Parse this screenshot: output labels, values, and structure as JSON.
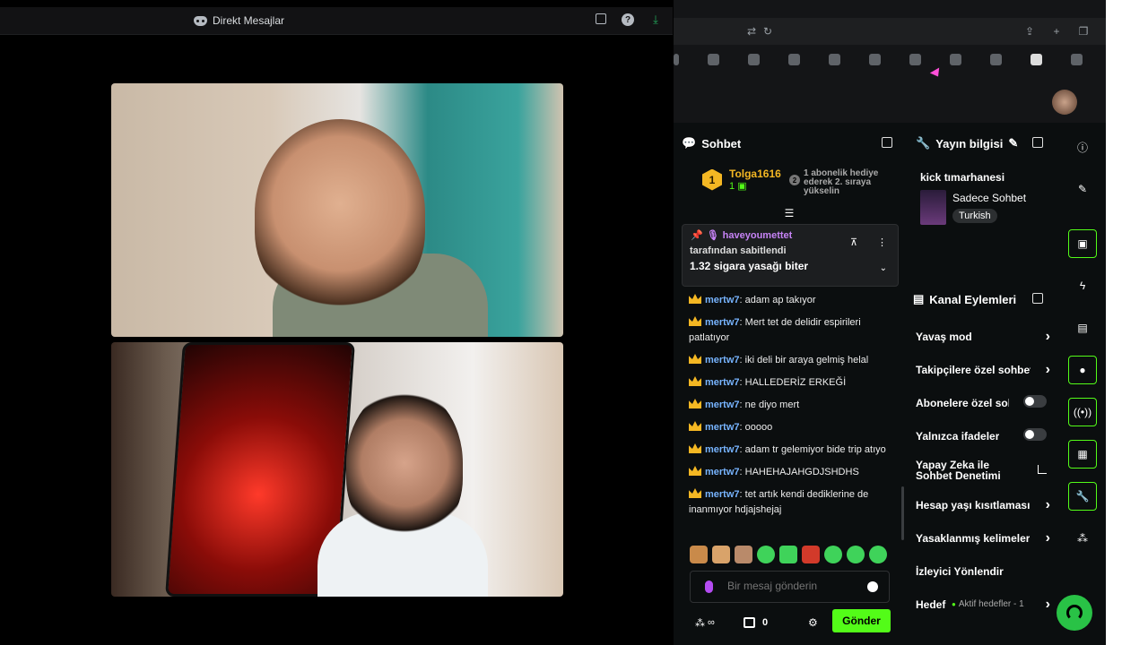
{
  "dm": {
    "title": "Direkt Mesajlar"
  },
  "chat": {
    "header": "Sohbet",
    "sub_goal": {
      "rank": "1",
      "user": "Tolga1616",
      "gift_count": "1",
      "hint_rank": "2",
      "hint": "1 abonelik hediye ederek 2. sıraya yükselin"
    },
    "pinned": {
      "user": "haveyoumettet",
      "by": "tarafından sabitlendi",
      "message": "1.32 sigara yasağı biter"
    },
    "messages": [
      {
        "user": "mertw7",
        "text": "adam ap takıyor"
      },
      {
        "user": "mertw7",
        "text": "Mert tet de delidir espirileri patlatıyor"
      },
      {
        "user": "mertw7",
        "text": "iki deli bir araya gelmiş helal"
      },
      {
        "user": "mertw7",
        "text": "HALLEDERİZ ERKEĞİ"
      },
      {
        "user": "mertw7",
        "text": "ne diyo mert"
      },
      {
        "user": "mertw7",
        "text": "ooooo"
      },
      {
        "user": "mertw7",
        "text": "adam tr gelemiyor bide trip atıyo"
      },
      {
        "user": "mertw7",
        "text": "HAHEHAJAHGDJSHDHS"
      },
      {
        "user": "mertw7",
        "text": "tet artık kendi dediklerine de inanmıyor hdjajshejaj"
      }
    ],
    "input_placeholder": "Bir mesaj gönderin",
    "store_count": "0",
    "send_label": "Gönder",
    "infinity": "∞"
  },
  "stream_info": {
    "header": "Yayın bilgisi",
    "title": "kick tımarhanesi",
    "category": "Sadece Sohbet",
    "language": "Turkish"
  },
  "channel_actions": {
    "header": "Kanal Eylemleri",
    "items": [
      {
        "label": "Yavaş mod",
        "control": "chevron"
      },
      {
        "label": "Takipçilere özel sohbet",
        "control": "chevron"
      },
      {
        "label": "Abonelere özel sohbet",
        "control": "toggle"
      },
      {
        "label": "Yalnızca ifadeler",
        "control": "toggle"
      },
      {
        "label": "Yapay Zeka ile Sohbet Denetimi",
        "control": "external"
      },
      {
        "label": "Hesap yaşı kısıtlaması",
        "control": "chevron"
      },
      {
        "label": "Yasaklanmış kelimeler",
        "control": "chevron"
      },
      {
        "label": "İzleyici Yönlendir",
        "control": "none"
      },
      {
        "label": "Hedefler",
        "control": "chevron",
        "sub": "Aktif hedefler - 1"
      }
    ]
  },
  "colors": {
    "kick_green": "#53fc18",
    "gold": "#f4b723",
    "username_blue": "#77b4ff",
    "pinned_purple": "#c683f5"
  }
}
